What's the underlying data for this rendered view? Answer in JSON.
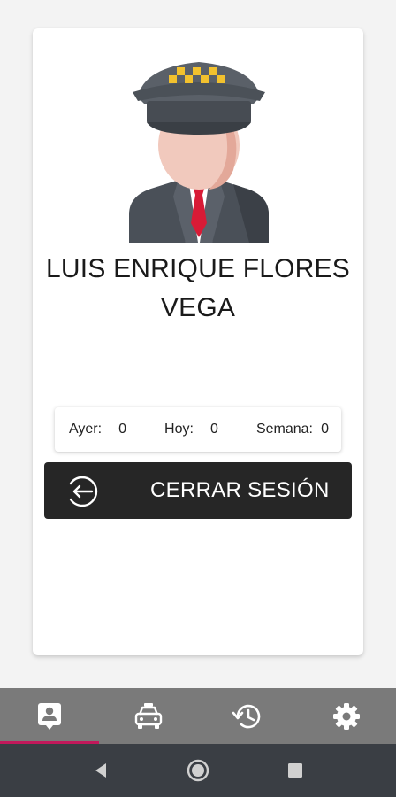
{
  "profile": {
    "name": "LUIS ENRIQUE FLORES VEGA"
  },
  "stats": {
    "yesterday_label": "Ayer:",
    "yesterday_value": "0",
    "today_label": "Hoy:",
    "today_value": "0",
    "week_label": "Semana:",
    "week_value": "0"
  },
  "logout": {
    "label": "CERRAR SESIÓN"
  },
  "bottom_nav": {
    "items": [
      {
        "icon": "profile-badge-icon",
        "active": true
      },
      {
        "icon": "taxi-icon",
        "active": false
      },
      {
        "icon": "history-icon",
        "active": false
      },
      {
        "icon": "gear-icon",
        "active": false
      }
    ]
  },
  "colors": {
    "accent": "#c2185b",
    "nav_bg": "#7a7a7a",
    "button_bg": "#262626",
    "system_bar": "#3a3e44"
  }
}
